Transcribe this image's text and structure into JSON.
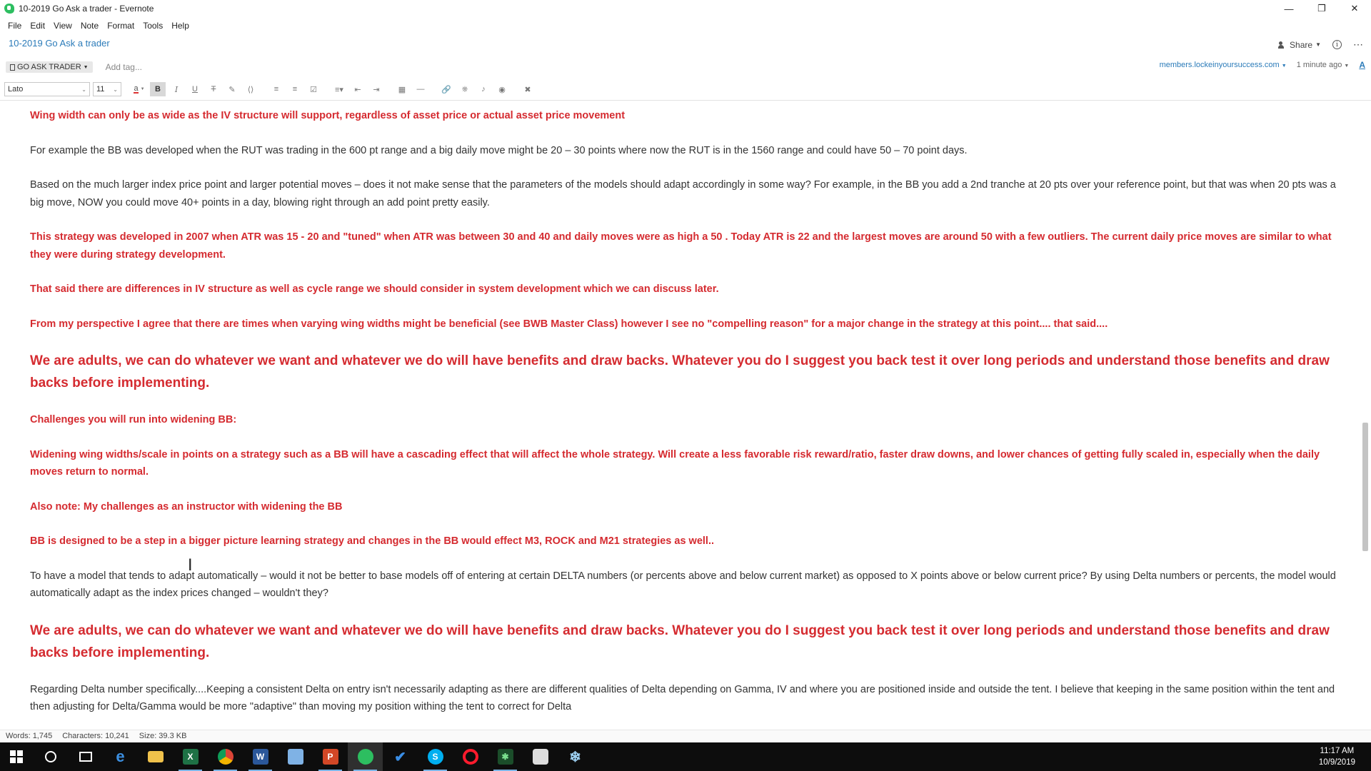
{
  "window": {
    "title": "10-2019 Go Ask a trader - Evernote"
  },
  "menu": [
    "File",
    "Edit",
    "View",
    "Note",
    "Format",
    "Tools",
    "Help"
  ],
  "note": {
    "title": "10-2019 Go Ask a trader",
    "share_label": "Share",
    "notebook": "GO ASK TRADER",
    "add_tag_placeholder": "Add tag...",
    "source_url": "members.lockeinyoursuccess.com",
    "updated": "1 minute ago"
  },
  "toolbar": {
    "font": "Lato",
    "size": "11"
  },
  "content": [
    {
      "style": "red",
      "text": "Wing width can only be as wide as the IV structure will support, regardless of asset price or actual asset price movement"
    },
    {
      "style": "normal",
      "text": "For example the BB was developed when the RUT was trading in the 600 pt range and a big daily move might be 20 – 30 points where now the RUT is in the 1560 range and could have 50 – 70 point days."
    },
    {
      "style": "normal",
      "text": " Based on the much larger index price point and larger potential moves – does it not make sense that the parameters of the models should adapt accordingly in some way?  For example, in the BB you add a 2nd tranche at 20 pts over your reference point, but that was when 20 pts was a big move, NOW you could move 40+ points in a day, blowing right through an add point pretty easily."
    },
    {
      "style": "red",
      "text": "This strategy was developed in 2007 when ATR was 15 - 20 and \"tuned\" when ATR was between 30 and 40 and daily moves were as high a 50 . Today ATR is 22 and the largest moves  are  around 50 with a few outliers. The current daily price moves are similar to what they were during strategy development."
    },
    {
      "style": "red",
      "text": "That said there are differences in IV structure as well as cycle range we should consider in system development which we can discuss later."
    },
    {
      "style": "red",
      "text": "From my perspective I agree that there are times when varying wing  widths might be beneficial (see BWB Master Class) however I see no \"compelling reason\" for a major change in the strategy at this point.... that said...."
    },
    {
      "style": "big",
      "text": "We are adults, we can do whatever we want and whatever we do will have benefits and draw backs. Whatever you do I suggest  you back test it over long periods and understand those benefits and draw backs before implementing."
    },
    {
      "style": "red",
      "text": "Challenges you will run into widening BB:"
    },
    {
      "style": "red",
      "text": "Widening wing widths/scale in points on a strategy such as a BB will have a cascading effect that will affect the whole strategy. Will create a less favorable risk reward/ratio, faster draw downs, and lower chances of getting fully scaled in, especially when the daily moves return to normal."
    },
    {
      "style": "red",
      "text": "Also note: My challenges as an instructor with widening the BB"
    },
    {
      "style": "red",
      "text": " BB is designed to be a step in  a bigger picture learning strategy and changes in the BB would  effect M3, ROCK and M21 strategies as well.."
    },
    {
      "style": "normal",
      "text": "To have a model that tends to adapt automatically – would it not be better to base models off of entering at certain DELTA numbers (or percents above and below current market) as opposed to X points above or below current price?  By using Delta numbers or percents, the model would automatically adapt as the index prices changed – wouldn't they?"
    },
    {
      "style": "big",
      "text": "We are adults, we can do whatever we want and whatever we do will have benefits and draw backs. Whatever you do I suggest  you back test it over long periods and understand those benefits and draw backs before implementing."
    },
    {
      "style": "normal",
      "text": "Regarding Delta number specifically....Keeping a consistent Delta on entry isn't necessarily adapting as there are different qualities of Delta  depending on Gamma, IV and where you are positioned inside and outside the tent. I believe that keeping in the same position within the tent and then adjusting for Delta/Gamma would be more \"adaptive\" than moving my position withing the tent to correct for Delta"
    }
  ],
  "status": {
    "words": "Words: 1,745",
    "characters": "Characters: 10,241",
    "size": "Size: 39.3 KB"
  },
  "taskbar": {
    "apps": [
      "start",
      "search",
      "task-view",
      "edge",
      "file-explorer",
      "excel",
      "chrome",
      "word",
      "notepad",
      "powerpoint",
      "evernote",
      "todo",
      "skype",
      "opera",
      "app-green",
      "camera",
      "snowflake"
    ],
    "time": "11:17 AM",
    "date": "10/9/2019"
  },
  "colors": {
    "accent": "#2b7bb9",
    "emphasis_red": "#d52b30",
    "evernote_green": "#2dbe60"
  }
}
